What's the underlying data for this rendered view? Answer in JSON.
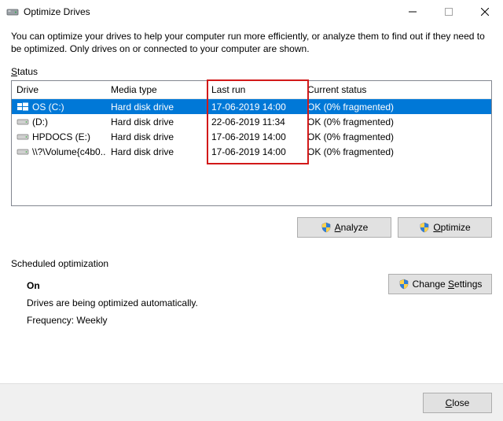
{
  "window": {
    "title": "Optimize Drives"
  },
  "intro": "You can optimize your drives to help your computer run more efficiently, or analyze them to find out if they need to be optimized. Only drives on or connected to your computer are shown.",
  "status_label_pre": "S",
  "status_label_post": "tatus",
  "columns": {
    "drive": "Drive",
    "media": "Media type",
    "last": "Last run",
    "status": "Current status"
  },
  "rows": [
    {
      "icon": "os",
      "drive": "OS (C:)",
      "media": "Hard disk drive",
      "last": "17-06-2019 14:00",
      "status": "OK (0% fragmented)",
      "selected": true
    },
    {
      "icon": "hdd",
      "drive": "(D:)",
      "media": "Hard disk drive",
      "last": "22-06-2019 11:34",
      "status": "OK (0% fragmented)",
      "selected": false
    },
    {
      "icon": "hdd",
      "drive": "HPDOCS (E:)",
      "media": "Hard disk drive",
      "last": "17-06-2019 14:00",
      "status": "OK (0% fragmented)",
      "selected": false
    },
    {
      "icon": "hdd",
      "drive": "\\\\?\\Volume{c4b0...",
      "media": "Hard disk drive",
      "last": "17-06-2019 14:00",
      "status": "OK (0% fragmented)",
      "selected": false
    }
  ],
  "buttons": {
    "analyze_u": "A",
    "analyze_rest": "nalyze",
    "optimize_u": "O",
    "optimize_rest": "ptimize",
    "change_u": "S",
    "change_pre": "Change ",
    "change_post": "ettings",
    "close_u": "C",
    "close_rest": "lose"
  },
  "sched": {
    "title": "Scheduled optimization",
    "state": "On",
    "desc": "Drives are being optimized automatically.",
    "freq": "Frequency: Weekly"
  }
}
